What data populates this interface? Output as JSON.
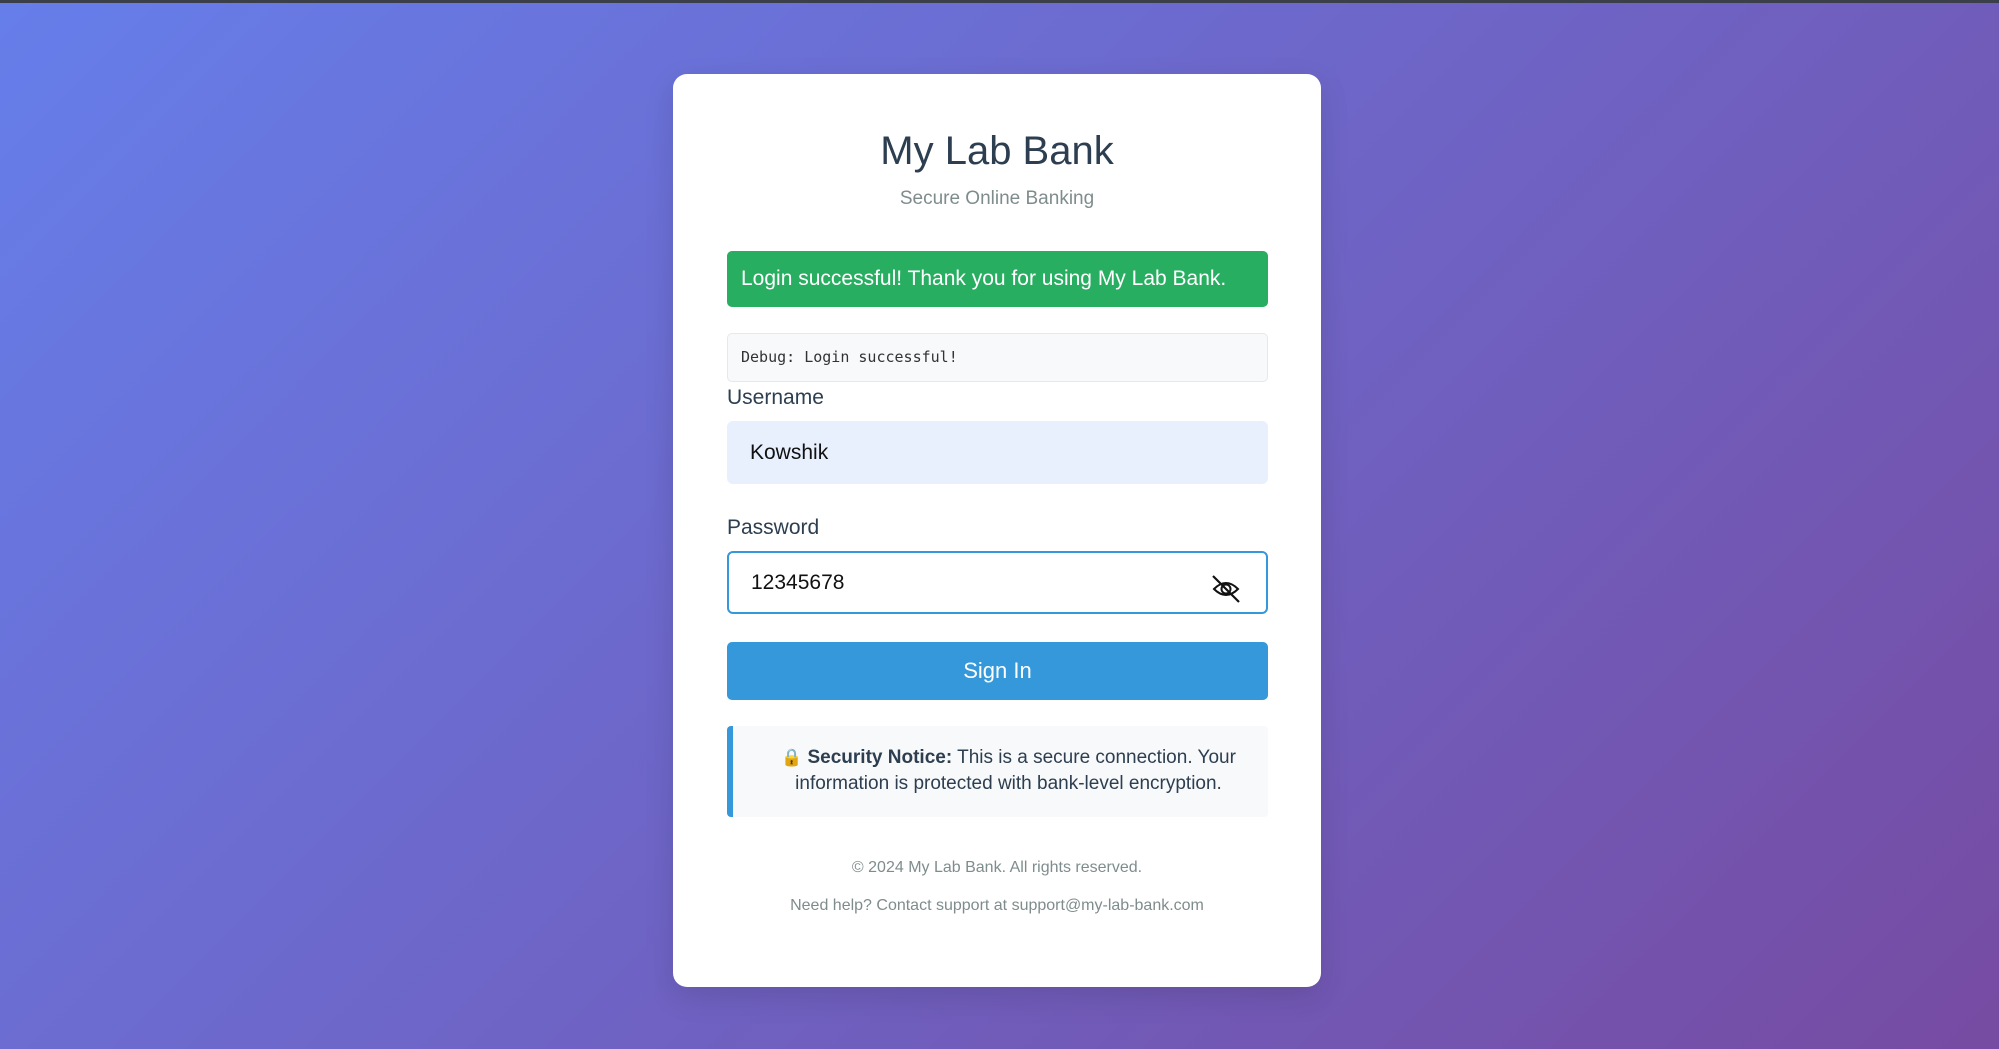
{
  "bank": {
    "title": "My Lab Bank",
    "subtitle": "Secure Online Banking"
  },
  "alert": {
    "message": "Login successful! Thank you for using My Lab Bank.",
    "color": "#27ae60"
  },
  "debug": {
    "text": "Debug: Login successful!"
  },
  "form": {
    "username_label": "Username",
    "username_value": "Kowshik",
    "password_label": "Password",
    "password_value": "12345678",
    "toggle_icon": "eye-off-icon",
    "submit_label": "Sign In"
  },
  "notice": {
    "icon": "lock-icon",
    "heading": "Security Notice:",
    "body": "This is a secure connection. Your information is protected with bank-level encryption."
  },
  "footer": {
    "copyright": "© 2024 My Lab Bank. All rights reserved.",
    "help": "Need help? Contact support at support@my-lab-bank.com"
  },
  "colors": {
    "accent": "#3498db",
    "gradient_start": "#667eea",
    "gradient_end": "#764ba2"
  }
}
